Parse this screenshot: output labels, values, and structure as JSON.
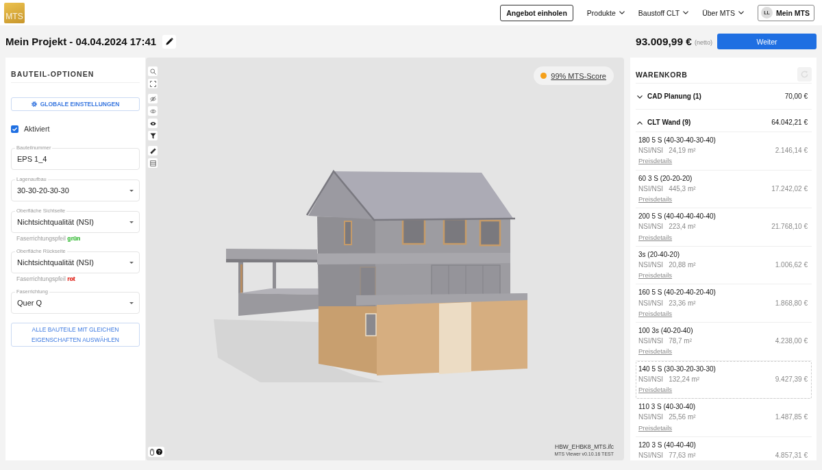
{
  "header": {
    "logo": "MTS",
    "quote_button": "Angebot einholen",
    "nav": [
      {
        "label": "Produkte"
      },
      {
        "label": "Baustoff CLT"
      },
      {
        "label": "Über MTS"
      }
    ],
    "account": {
      "initials": "LL",
      "label": "Mein MTS"
    }
  },
  "project": {
    "title": "Mein Projekt - 04.04.2024 17:41",
    "total": "93.009,99 €",
    "total_note": "(netto)",
    "next_button": "Weiter"
  },
  "options_panel": {
    "title": "BAUTEIL-OPTIONEN",
    "global_button": "GLOBALE EINSTELLUNGEN",
    "activated": {
      "label": "Aktiviert",
      "checked": true
    },
    "fields": [
      {
        "kind": "text",
        "label": "Bauteilnummer",
        "value": "EPS 1_4"
      },
      {
        "kind": "select",
        "label": "Lagenaufbau",
        "value": "30-30-20-30-30"
      },
      {
        "kind": "select",
        "label": "Oberfläche Sichtseite",
        "value": "Nichtsichtqualität (NSI)",
        "hint": {
          "text": "Faserrichtungspfeil",
          "value": "grün",
          "color": "#5ec85e"
        }
      },
      {
        "kind": "select",
        "label": "Oberfläche Rückseite",
        "value": "Nichtsichtqualität (NSI)",
        "hint": {
          "text": "Faserrichtungspfeil",
          "value": "rot",
          "color": "#e5473f"
        }
      },
      {
        "kind": "select",
        "label": "Faserrichtung",
        "value": "Quer Q"
      }
    ],
    "select_all_button": "ALLE BAUTEILE MIT GLEICHEN EIGENSCHAFTEN AUSWÄHLEN"
  },
  "viewer": {
    "score": "99% MTS-Score",
    "file_name": "HBW_EHBK8_MTS.ifc",
    "version": "MTS Viewer v0.10.16 TEST"
  },
  "cart": {
    "title": "WARENKORB",
    "refresh_button": {
      "disabled": true
    },
    "groups": [
      {
        "name": "CAD Planung (1)",
        "total": "70,00 €",
        "expanded": false
      },
      {
        "name": "CLT Wand (9)",
        "total": "64.042,21 €",
        "expanded": true,
        "items": [
          {
            "name": "180 5 S (40-30-40-30-40)",
            "surface": "NSI/NSI",
            "area": "24,19 m²",
            "price": "2.146,14 €",
            "link": "Preisdetails",
            "selected": false
          },
          {
            "name": "60 3 S (20-20-20)",
            "surface": "NSI/NSI",
            "area": "445,3 m²",
            "price": "17.242,02 €",
            "link": "Preisdetails",
            "selected": false
          },
          {
            "name": "200 5 S (40-40-40-40-40)",
            "surface": "NSI/NSI",
            "area": "223,4 m²",
            "price": "21.768,10 €",
            "link": "Preisdetails",
            "selected": false
          },
          {
            "name": "3s (20-40-20)",
            "surface": "NSI/NSI",
            "area": "20,88 m²",
            "price": "1.006,62 €",
            "link": "Preisdetails",
            "selected": false
          },
          {
            "name": "160 5 S (40-20-40-20-40)",
            "surface": "NSI/NSI",
            "area": "23,36 m²",
            "price": "1.868,80 €",
            "link": "Preisdetails",
            "selected": false
          },
          {
            "name": "100 3s (40-20-40)",
            "surface": "NSI/NSI",
            "area": "78,7 m²",
            "price": "4.238,00 €",
            "link": "Preisdetails",
            "selected": false
          },
          {
            "name": "140 5 S (30-30-20-30-30)",
            "surface": "NSI/NSI",
            "area": "132,24 m²",
            "price": "9.427,39 €",
            "link": "Preisdetails",
            "selected": true
          },
          {
            "name": "110 3 S (40-30-40)",
            "surface": "NSI/NSI",
            "area": "25,56 m²",
            "price": "1.487,85 €",
            "link": "Preisdetails",
            "selected": false
          },
          {
            "name": "120 3 S (40-40-40)",
            "surface": "NSI/NSI",
            "area": "77,63 m²",
            "price": "4.857,31 €",
            "selected": false
          }
        ]
      }
    ]
  }
}
